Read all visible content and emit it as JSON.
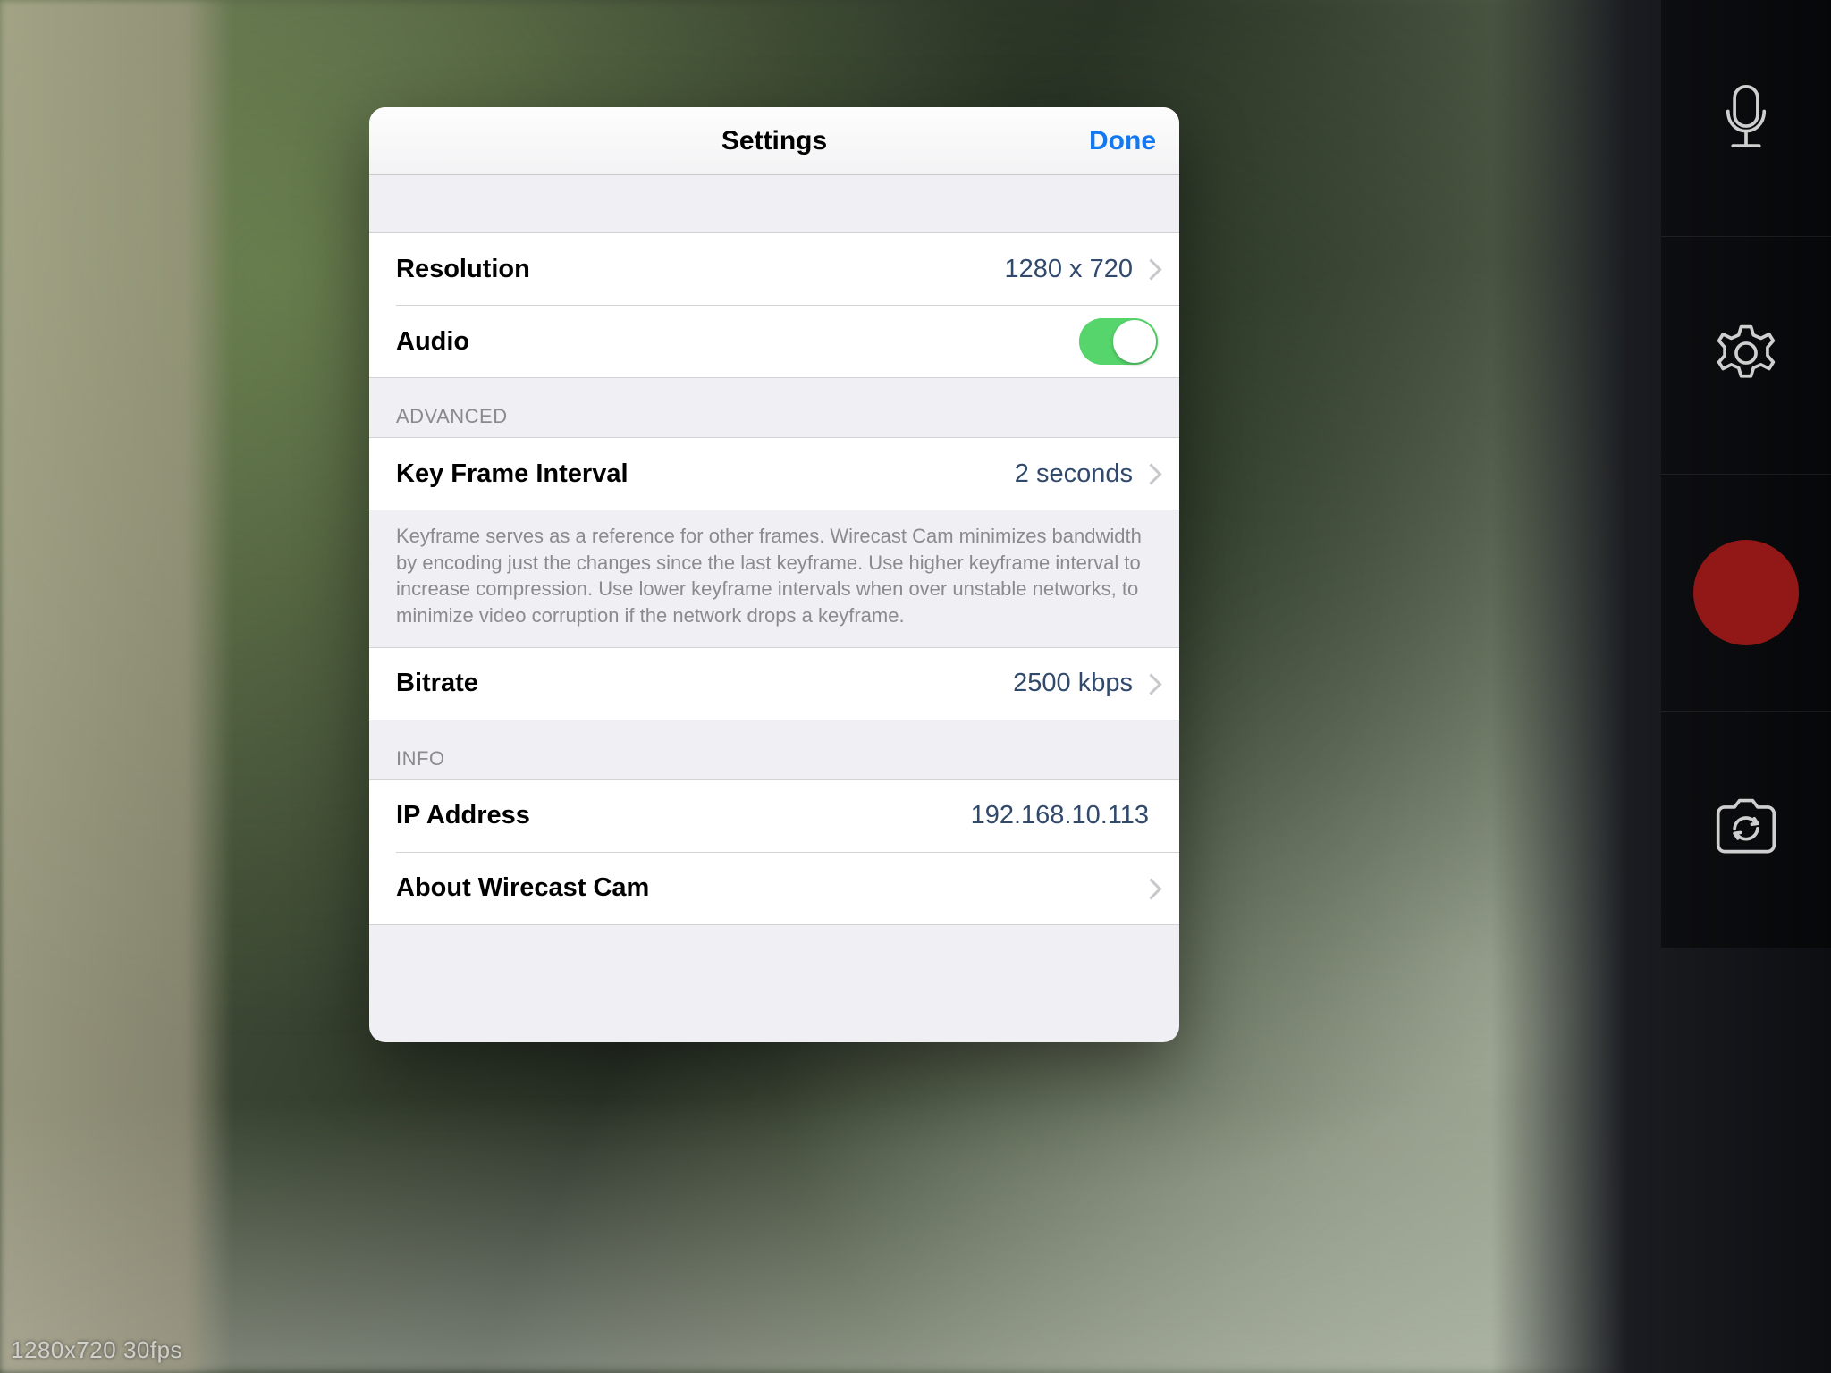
{
  "hud": {
    "status": "1280x720 30fps"
  },
  "rail": {
    "mic_icon": "microphone-icon",
    "gear_icon": "settings-gear-icon",
    "record_icon": "record-button",
    "switch_icon": "switch-camera-icon"
  },
  "modal": {
    "title": "Settings",
    "done": "Done",
    "sections": {
      "basic": {
        "resolution_label": "Resolution",
        "resolution_value": "1280 x 720",
        "audio_label": "Audio",
        "audio_on": true
      },
      "advanced": {
        "header": "ADVANCED",
        "keyframe_label": "Key Frame Interval",
        "keyframe_value": "2 seconds",
        "keyframe_footer": "Keyframe serves as a reference for other frames. Wirecast Cam minimizes bandwidth by encoding just the changes since the last keyframe. Use higher keyframe interval to increase compression.  Use lower keyframe intervals when over unstable networks, to minimize video corruption if the network drops a keyframe.",
        "bitrate_label": "Bitrate",
        "bitrate_value": "2500 kbps"
      },
      "info": {
        "header": "INFO",
        "ip_label": "IP Address",
        "ip_value": "192.168.10.113",
        "about_label": "About Wirecast Cam"
      }
    }
  }
}
